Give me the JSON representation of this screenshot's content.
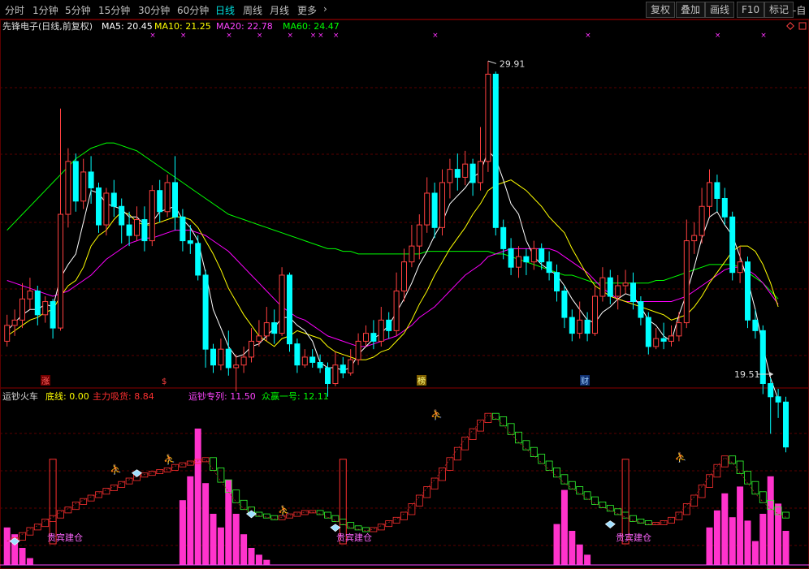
{
  "toolbar": {
    "timeframes": [
      "分时",
      "1分钟",
      "5分钟",
      "15分钟",
      "30分钟",
      "60分钟",
      "日线",
      "周线",
      "月线",
      "更多"
    ],
    "active": "日线",
    "more_chevron": "›",
    "right_buttons": [
      "复权",
      "叠加",
      "画线",
      "F10",
      "标记"
    ],
    "edge_label": "-自"
  },
  "colors": {
    "up": "#ff4040",
    "down": "#00ffff",
    "ma5": "#ffffff",
    "ma10": "#ffff00",
    "ma20": "#ff00ff",
    "ma60": "#00ff00",
    "grid": "#5a0000",
    "bar": "#ff33cc"
  },
  "main_legend": {
    "title": "先锋电子(日线,前复权)",
    "items": [
      {
        "label": "MA5: 20.45",
        "color": "#ffffff"
      },
      {
        "label": "MA10: 21.25",
        "color": "#ffff00"
      },
      {
        "label": "MA20: 22.78",
        "color": "#ff44ff"
      },
      {
        "label": "MA60: 24.47",
        "color": "#00ff00"
      }
    ]
  },
  "sub_legend": {
    "title": "运钞火车",
    "items": [
      {
        "label": "底线: 0.00",
        "color": "#ffff00"
      },
      {
        "label": "主力吸货: 8.84",
        "color": "#ff3030"
      },
      {
        "label": "运钞专列: 11.50",
        "color": "#ff44ff"
      },
      {
        "label": "众赢一号: 12.11",
        "color": "#00ff00"
      }
    ]
  },
  "markers": {
    "zhang": "涨",
    "dollar": "$",
    "bang": "榜",
    "cai": "财"
  },
  "price_labels": {
    "high": "29.91",
    "low": "19.51"
  },
  "signal_text": "贵宾建仓",
  "chart_data": {
    "type": "candlestick",
    "ylim": [
      18.4,
      31.6
    ],
    "count": 103,
    "candles": [
      [
        19.8,
        20.4,
        20.8,
        19.6
      ],
      [
        20.4,
        20.6,
        21.0,
        20.0
      ],
      [
        20.6,
        21.4,
        22.0,
        20.3
      ],
      [
        21.4,
        21.7,
        22.2,
        21.0
      ],
      [
        21.7,
        20.8,
        21.9,
        20.4
      ],
      [
        20.8,
        21.3,
        21.5,
        20.5
      ],
      [
        21.3,
        20.3,
        21.4,
        19.9
      ],
      [
        20.3,
        24.6,
        28.6,
        20.2
      ],
      [
        24.6,
        26.6,
        27.1,
        24.1
      ],
      [
        26.6,
        25.1,
        26.9,
        24.7
      ],
      [
        25.1,
        26.2,
        26.7,
        24.8
      ],
      [
        26.2,
        25.6,
        26.8,
        25.0
      ],
      [
        25.6,
        24.2,
        25.8,
        23.9
      ],
      [
        24.2,
        25.4,
        25.6,
        23.8
      ],
      [
        25.4,
        24.9,
        25.9,
        24.5
      ],
      [
        24.9,
        24.2,
        25.2,
        23.5
      ],
      [
        24.2,
        23.8,
        24.7,
        23.4
      ],
      [
        23.8,
        24.4,
        24.9,
        23.6
      ],
      [
        24.4,
        23.6,
        24.9,
        23.2
      ],
      [
        23.6,
        25.5,
        25.7,
        23.4
      ],
      [
        25.5,
        24.7,
        25.9,
        24.3
      ],
      [
        24.7,
        25.8,
        26.1,
        24.5
      ],
      [
        25.8,
        24.5,
        26.8,
        24.0
      ],
      [
        24.5,
        23.6,
        24.8,
        23.2
      ],
      [
        23.6,
        23.5,
        24.2,
        23.1
      ],
      [
        23.5,
        22.3,
        23.8,
        22.1
      ],
      [
        22.3,
        19.5,
        22.5,
        18.8
      ],
      [
        19.5,
        18.9,
        19.7,
        18.6
      ],
      [
        18.9,
        19.5,
        19.9,
        18.7
      ],
      [
        19.5,
        18.8,
        20.2,
        18.5
      ],
      [
        18.8,
        18.9,
        19.3,
        17.9
      ],
      [
        18.9,
        19.2,
        19.6,
        18.6
      ],
      [
        19.2,
        19.8,
        20.3,
        19.0
      ],
      [
        19.8,
        20.0,
        20.6,
        19.6
      ],
      [
        20.0,
        20.5,
        21.1,
        19.8
      ],
      [
        20.5,
        20.1,
        21.0,
        19.7
      ],
      [
        20.1,
        22.3,
        22.6,
        20.0
      ],
      [
        22.3,
        19.7,
        22.4,
        19.4
      ],
      [
        19.7,
        18.9,
        19.9,
        18.6
      ],
      [
        18.9,
        19.2,
        19.5,
        18.8
      ],
      [
        19.2,
        19.0,
        19.5,
        18.8
      ],
      [
        19.0,
        18.8,
        19.3,
        18.6
      ],
      [
        18.8,
        18.2,
        19.0,
        17.7
      ],
      [
        18.2,
        18.9,
        19.4,
        18.1
      ],
      [
        18.9,
        18.6,
        19.2,
        18.4
      ],
      [
        18.6,
        19.1,
        19.5,
        18.5
      ],
      [
        19.1,
        19.8,
        20.1,
        18.9
      ],
      [
        19.8,
        20.1,
        20.4,
        19.6
      ],
      [
        20.1,
        19.8,
        20.6,
        19.5
      ],
      [
        19.8,
        20.6,
        21.1,
        19.6
      ],
      [
        20.6,
        20.2,
        20.9,
        19.9
      ],
      [
        20.2,
        21.7,
        22.4,
        20.0
      ],
      [
        21.7,
        22.8,
        23.3,
        21.3
      ],
      [
        22.8,
        23.4,
        24.2,
        22.6
      ],
      [
        23.4,
        24.2,
        24.6,
        22.9
      ],
      [
        24.2,
        25.4,
        26.0,
        23.9
      ],
      [
        25.4,
        24.1,
        25.8,
        23.7
      ],
      [
        24.1,
        25.8,
        26.3,
        23.8
      ],
      [
        25.8,
        26.3,
        26.7,
        25.2
      ],
      [
        26.3,
        26.0,
        26.9,
        25.5
      ],
      [
        26.0,
        26.5,
        27.0,
        25.7
      ],
      [
        26.5,
        25.8,
        26.7,
        25.3
      ],
      [
        25.8,
        26.6,
        27.9,
        25.5
      ],
      [
        26.6,
        29.9,
        30.4,
        26.2
      ],
      [
        29.9,
        24.1,
        30.0,
        23.8
      ],
      [
        24.1,
        23.3,
        24.4,
        22.9
      ],
      [
        23.3,
        22.6,
        23.7,
        22.3
      ],
      [
        22.6,
        23.0,
        23.4,
        22.2
      ],
      [
        23.0,
        22.8,
        23.3,
        22.3
      ],
      [
        22.8,
        23.3,
        23.6,
        22.5
      ],
      [
        23.3,
        22.8,
        23.5,
        22.5
      ],
      [
        22.8,
        22.4,
        23.2,
        22.1
      ],
      [
        22.4,
        21.7,
        22.7,
        21.3
      ],
      [
        21.7,
        20.7,
        21.9,
        20.3
      ],
      [
        20.7,
        20.1,
        21.0,
        19.8
      ],
      [
        20.1,
        20.6,
        21.3,
        19.9
      ],
      [
        20.6,
        20.1,
        20.9,
        19.8
      ],
      [
        20.1,
        21.5,
        21.9,
        20.0
      ],
      [
        21.5,
        22.2,
        22.6,
        21.3
      ],
      [
        22.2,
        21.5,
        22.5,
        21.2
      ],
      [
        21.5,
        21.9,
        22.3,
        21.0
      ],
      [
        21.9,
        22.0,
        22.5,
        21.6
      ],
      [
        22.0,
        21.3,
        22.4,
        21.0
      ],
      [
        21.3,
        20.7,
        21.5,
        20.4
      ],
      [
        20.7,
        19.6,
        20.9,
        19.3
      ],
      [
        19.6,
        19.9,
        20.3,
        19.5
      ],
      [
        19.9,
        19.8,
        20.5,
        19.5
      ],
      [
        19.8,
        20.0,
        20.4,
        19.6
      ],
      [
        20.0,
        20.5,
        20.9,
        19.8
      ],
      [
        20.5,
        23.6,
        24.4,
        20.3
      ],
      [
        23.6,
        23.8,
        24.3,
        23.1
      ],
      [
        23.8,
        24.9,
        25.6,
        23.5
      ],
      [
        24.9,
        25.8,
        26.3,
        24.5
      ],
      [
        25.8,
        25.2,
        26.1,
        24.7
      ],
      [
        25.2,
        24.5,
        25.6,
        24.2
      ],
      [
        24.5,
        22.4,
        24.7,
        22.1
      ],
      [
        22.4,
        22.8,
        23.4,
        22.0
      ],
      [
        22.8,
        20.6,
        23.0,
        20.3
      ],
      [
        20.6,
        20.2,
        21.0,
        19.9
      ],
      [
        20.2,
        18.2,
        20.4,
        17.8
      ],
      [
        18.2,
        17.7,
        18.4,
        16.3
      ],
      [
        17.7,
        17.5,
        18.0,
        16.9
      ],
      [
        17.5,
        15.8,
        17.7,
        15.6
      ]
    ],
    "ma5": [
      20.2,
      20.5,
      20.8,
      21.0,
      21.0,
      21.2,
      21.1,
      22.2,
      22.7,
      23.1,
      24.3,
      25.5,
      25.4,
      25.0,
      24.9,
      24.8,
      24.5,
      24.5,
      24.2,
      24.3,
      24.7,
      24.8,
      24.9,
      24.4,
      24.1,
      23.6,
      22.4,
      21.0,
      20.3,
      19.6,
      19.2,
      19.3,
      19.6,
      19.7,
      20.0,
      20.3,
      20.7,
      20.7,
      20.4,
      20.2,
      19.8,
      19.0,
      18.8,
      18.8,
      18.7,
      18.8,
      19.3,
      19.6,
      19.9,
      20.1,
      20.4,
      20.9,
      21.4,
      22.0,
      22.7,
      23.2,
      23.8,
      24.3,
      25.0,
      25.3,
      25.6,
      26.0,
      26.2,
      27.0,
      26.7,
      25.9,
      25.0,
      24.6,
      23.6,
      23.0,
      22.7,
      22.5,
      22.3,
      21.9,
      21.4,
      21.0,
      20.6,
      20.5,
      20.9,
      21.1,
      21.4,
      21.6,
      21.5,
      21.1,
      20.6,
      20.4,
      20.0,
      19.8,
      20.8,
      21.6,
      22.6,
      23.7,
      24.5,
      24.7,
      24.2,
      23.8,
      23.0,
      22.1,
      21.0,
      19.6,
      18.4,
      17.6
    ],
    "ma10": [
      20.0,
      20.2,
      20.4,
      20.6,
      20.7,
      20.9,
      21.0,
      21.5,
      21.9,
      22.1,
      22.6,
      23.4,
      23.8,
      24.0,
      24.4,
      24.7,
      24.6,
      24.3,
      24.2,
      24.2,
      24.3,
      24.4,
      24.5,
      24.5,
      24.4,
      24.1,
      23.6,
      23.1,
      22.5,
      21.8,
      21.3,
      20.8,
      20.4,
      20.0,
      19.8,
      19.6,
      19.9,
      20.0,
      20.2,
      20.1,
      20.0,
      19.9,
      19.6,
      19.4,
      19.3,
      19.2,
      19.1,
      19.1,
      19.2,
      19.4,
      19.5,
      19.8,
      20.1,
      20.6,
      21.2,
      21.7,
      22.3,
      22.8,
      23.3,
      23.7,
      24.1,
      24.6,
      25.0,
      25.5,
      25.7,
      25.8,
      25.9,
      25.7,
      25.5,
      25.2,
      24.9,
      24.5,
      24.2,
      23.9,
      23.3,
      22.8,
      22.3,
      21.9,
      21.7,
      21.5,
      21.4,
      21.3,
      21.2,
      21.1,
      21.0,
      20.9,
      20.8,
      20.6,
      20.7,
      20.8,
      21.1,
      21.5,
      22.0,
      22.4,
      22.8,
      23.2,
      23.4,
      23.4,
      23.2,
      22.7,
      22.0,
      21.1
    ],
    "ma20": [
      22.1,
      22.0,
      21.9,
      21.8,
      21.7,
      21.6,
      21.5,
      21.6,
      21.7,
      21.9,
      22.1,
      22.3,
      22.6,
      22.9,
      23.1,
      23.3,
      23.5,
      23.6,
      23.7,
      23.7,
      23.8,
      23.9,
      24.0,
      24.0,
      24.0,
      23.9,
      23.8,
      23.6,
      23.4,
      23.2,
      22.9,
      22.6,
      22.3,
      22.0,
      21.7,
      21.4,
      21.1,
      20.9,
      20.7,
      20.6,
      20.4,
      20.2,
      20.0,
      19.9,
      19.8,
      19.7,
      19.6,
      19.6,
      19.7,
      19.8,
      19.9,
      20.0,
      20.2,
      20.4,
      20.7,
      20.9,
      21.1,
      21.4,
      21.7,
      22.0,
      22.3,
      22.5,
      22.7,
      23.0,
      23.1,
      23.2,
      23.3,
      23.3,
      23.3,
      23.3,
      23.3,
      23.3,
      23.2,
      23.0,
      22.8,
      22.6,
      22.4,
      22.1,
      21.8,
      21.6,
      21.4,
      21.3,
      21.3,
      21.3,
      21.3,
      21.3,
      21.3,
      21.3,
      21.4,
      21.5,
      21.7,
      21.9,
      22.1,
      22.3,
      22.5,
      22.6,
      22.6,
      22.5,
      22.3,
      22.0,
      21.6,
      21.2
    ],
    "ma60": [
      24.0,
      24.3,
      24.6,
      24.9,
      25.2,
      25.5,
      25.8,
      26.1,
      26.4,
      26.7,
      26.9,
      27.1,
      27.2,
      27.3,
      27.3,
      27.2,
      27.1,
      27.0,
      26.8,
      26.6,
      26.4,
      26.2,
      26.0,
      25.8,
      25.6,
      25.4,
      25.2,
      25.0,
      24.8,
      24.6,
      24.5,
      24.4,
      24.3,
      24.2,
      24.1,
      24.0,
      23.9,
      23.8,
      23.7,
      23.6,
      23.5,
      23.4,
      23.3,
      23.3,
      23.2,
      23.2,
      23.1,
      23.1,
      23.1,
      23.1,
      23.1,
      23.1,
      23.1,
      23.1,
      23.1,
      23.2,
      23.2,
      23.2,
      23.2,
      23.2,
      23.2,
      23.2,
      23.2,
      23.2,
      23.1,
      23.1,
      23.0,
      22.9,
      22.8,
      22.7,
      22.6,
      22.5,
      22.4,
      22.3,
      22.3,
      22.2,
      22.1,
      22.0,
      22.0,
      22.0,
      22.0,
      22.0,
      22.0,
      22.0,
      22.0,
      22.1,
      22.1,
      22.2,
      22.3,
      22.4,
      22.5,
      22.6,
      22.7,
      22.7,
      22.7,
      22.7,
      22.6,
      22.4,
      22.2,
      22.0,
      21.7,
      21.4
    ],
    "sub_ylim": [
      0,
      100
    ],
    "train": [
      14,
      15,
      18,
      21,
      23,
      26,
      28,
      31,
      33,
      36,
      38,
      40,
      42,
      44,
      46,
      48,
      50,
      52,
      53,
      54,
      55,
      56,
      58,
      59,
      60,
      61,
      62,
      56,
      49,
      43,
      37,
      33,
      30,
      29,
      28,
      27,
      28,
      29,
      30,
      31,
      31,
      30,
      28,
      26,
      24,
      22,
      21,
      20,
      21,
      23,
      25,
      27,
      30,
      35,
      40,
      45,
      50,
      56,
      62,
      68,
      74,
      79,
      84,
      88,
      86,
      82,
      77,
      72,
      68,
      64,
      60,
      56,
      52,
      48,
      45,
      42,
      39,
      36,
      34,
      32,
      30,
      28,
      26,
      25,
      24,
      24,
      25,
      27,
      30,
      35,
      40,
      46,
      52,
      58,
      63,
      60,
      54,
      48,
      42,
      37,
      33,
      30,
      28
    ],
    "bars": [
      22,
      18,
      10,
      4,
      0,
      0,
      0,
      0,
      0,
      0,
      0,
      0,
      0,
      0,
      0,
      0,
      0,
      0,
      0,
      0,
      0,
      0,
      0,
      0,
      0,
      0,
      0,
      0,
      0,
      0,
      0,
      0,
      0,
      0,
      0,
      0,
      0,
      0,
      0,
      0,
      0,
      0,
      0,
      0,
      0,
      0,
      0,
      0,
      0,
      0,
      0,
      0,
      0,
      0,
      0,
      0,
      0,
      0,
      0,
      0,
      0,
      0,
      0,
      0,
      0,
      0,
      0,
      0,
      0,
      0,
      0,
      0,
      0,
      0,
      0,
      0,
      0,
      0,
      0,
      0,
      0,
      0,
      0,
      0,
      0,
      0,
      0,
      0,
      0,
      0,
      0,
      0,
      0,
      0,
      0,
      0,
      0,
      0,
      0,
      0,
      0,
      0,
      0
    ],
    "pink_bars": [
      {
        "i": 23,
        "v": 38
      },
      {
        "i": 24,
        "v": 52
      },
      {
        "i": 25,
        "v": 80
      },
      {
        "i": 26,
        "v": 48
      },
      {
        "i": 27,
        "v": 30
      },
      {
        "i": 28,
        "v": 22
      },
      {
        "i": 29,
        "v": 50
      },
      {
        "i": 30,
        "v": 30
      },
      {
        "i": 31,
        "v": 18
      },
      {
        "i": 32,
        "v": 10
      },
      {
        "i": 33,
        "v": 6
      },
      {
        "i": 34,
        "v": 3
      },
      {
        "i": 72,
        "v": 24
      },
      {
        "i": 73,
        "v": 44
      },
      {
        "i": 74,
        "v": 20
      },
      {
        "i": 75,
        "v": 12
      },
      {
        "i": 76,
        "v": 6
      },
      {
        "i": 92,
        "v": 22
      },
      {
        "i": 93,
        "v": 32
      },
      {
        "i": 94,
        "v": 42
      },
      {
        "i": 95,
        "v": 28
      },
      {
        "i": 96,
        "v": 46
      },
      {
        "i": 97,
        "v": 26
      },
      {
        "i": 98,
        "v": 14
      },
      {
        "i": 99,
        "v": 30
      },
      {
        "i": 100,
        "v": 52
      },
      {
        "i": 101,
        "v": 36
      },
      {
        "i": 102,
        "v": 20
      }
    ]
  }
}
